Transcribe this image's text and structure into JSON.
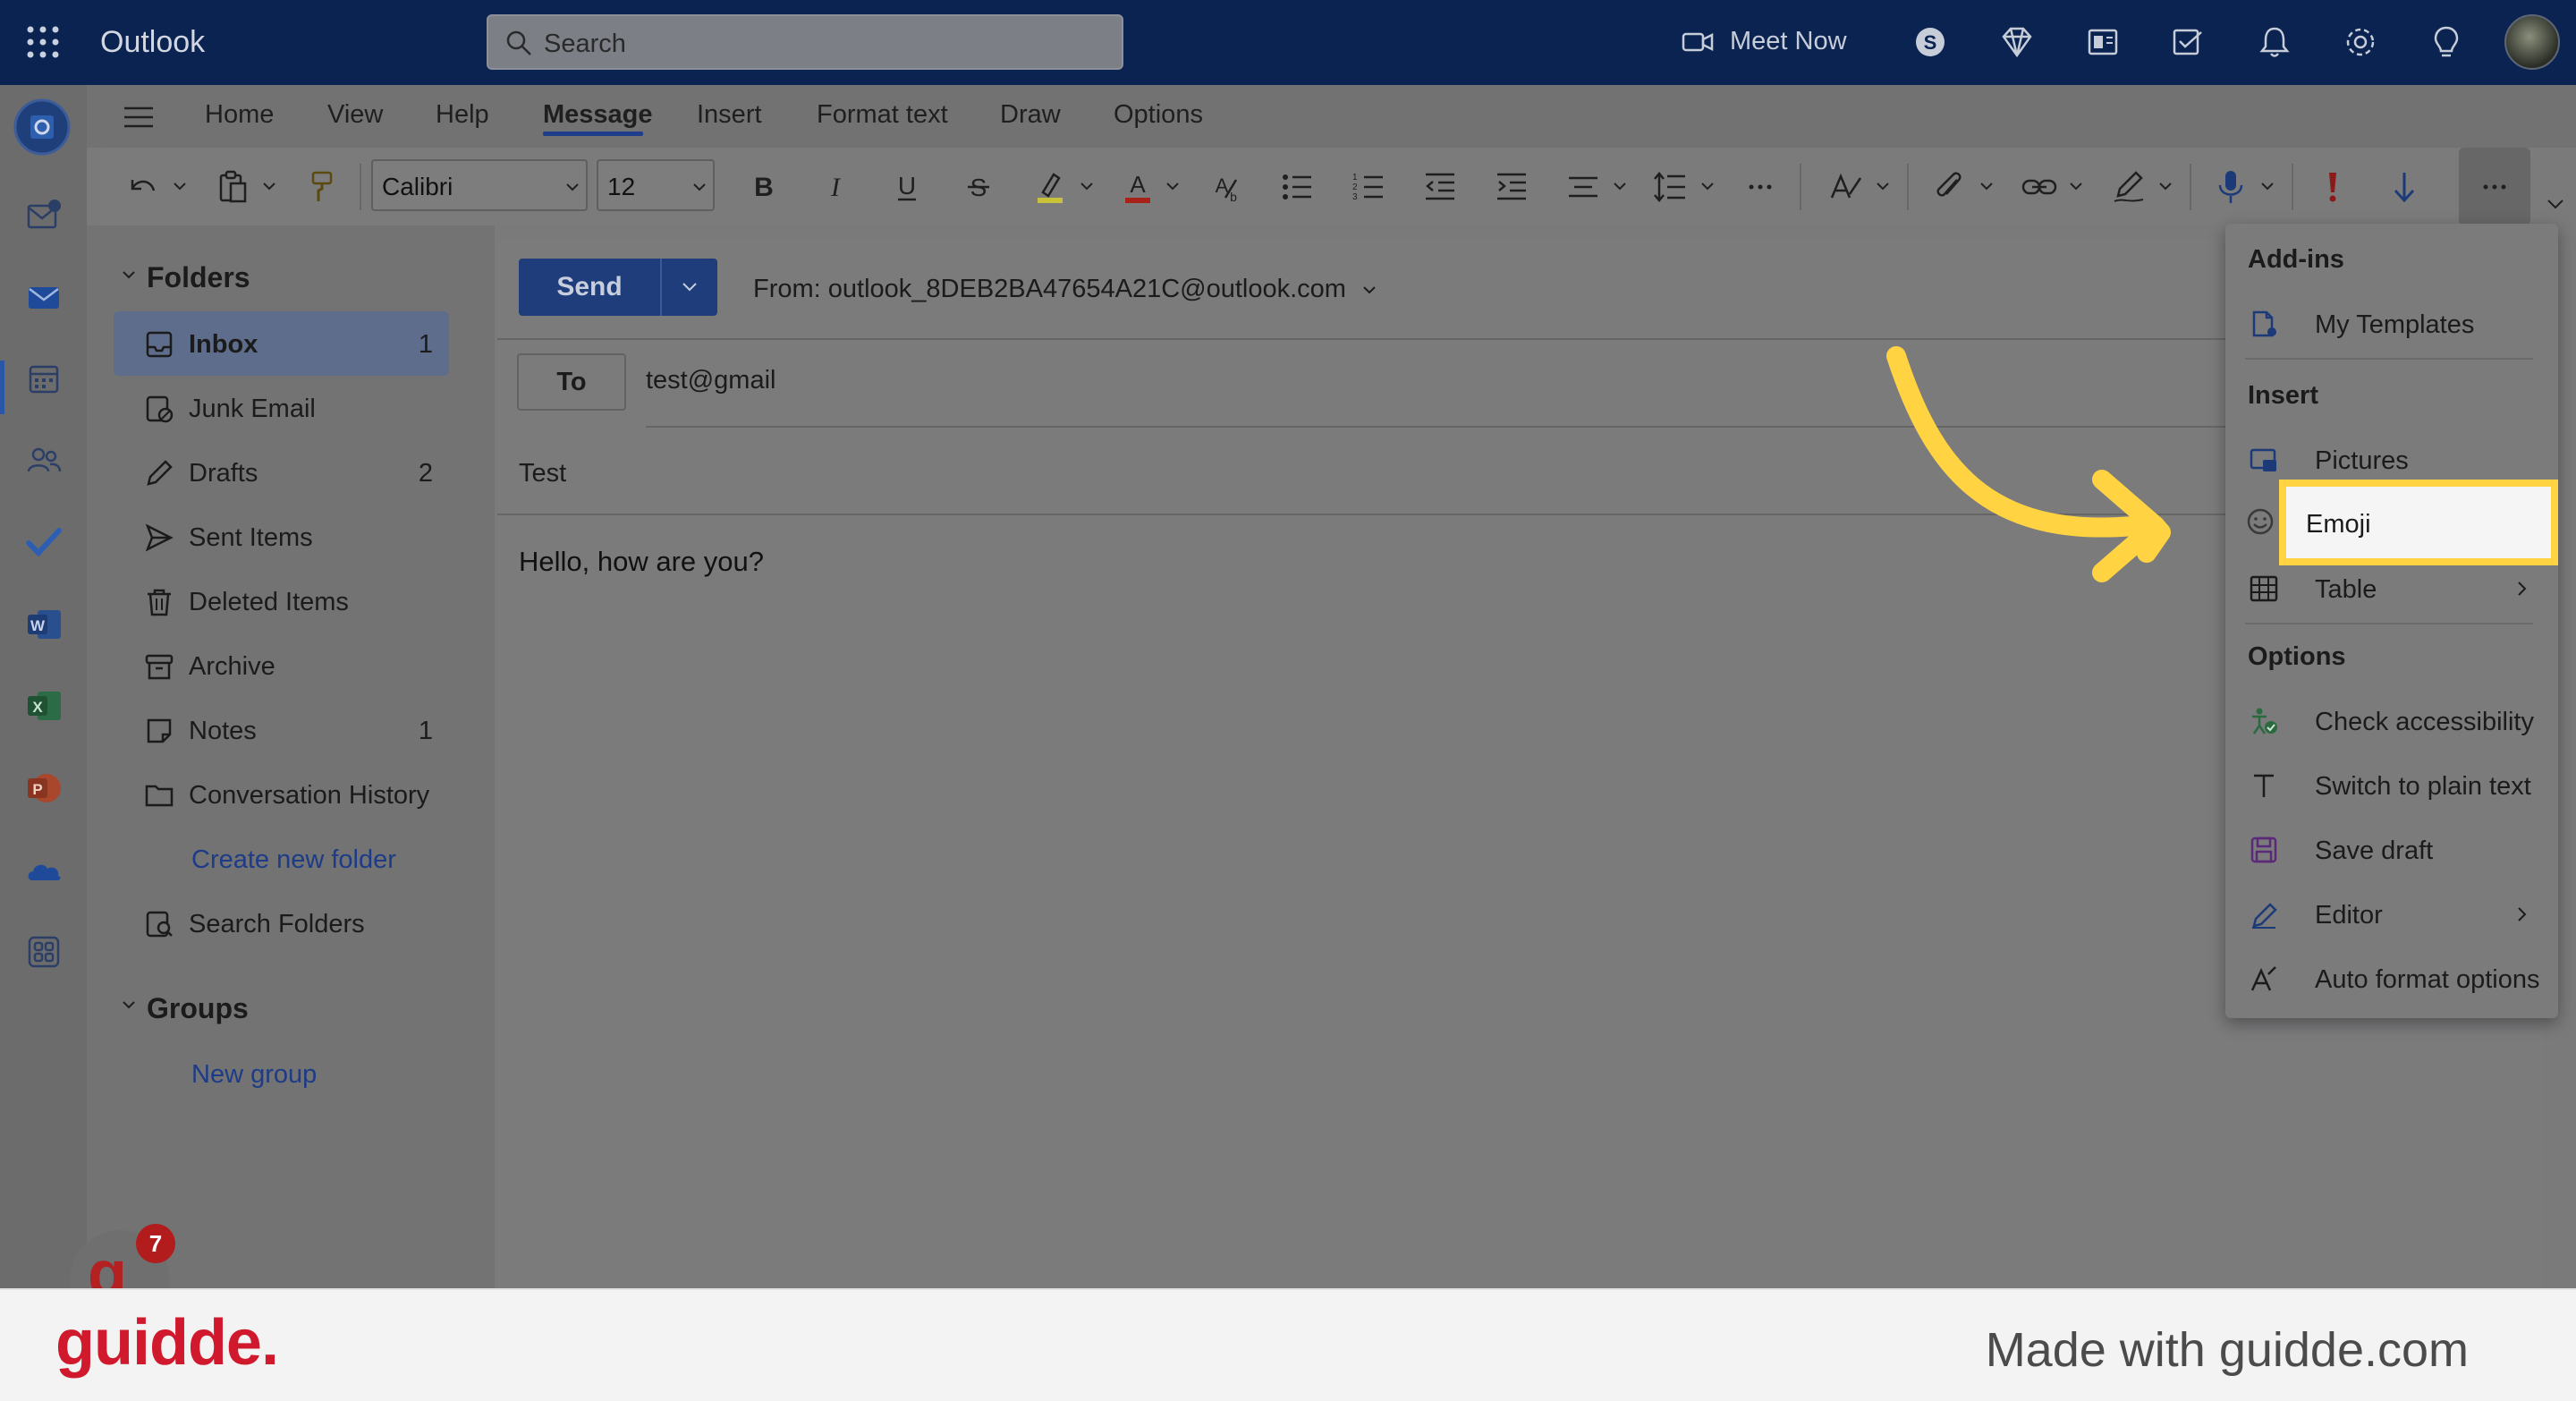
{
  "app": {
    "name": "Outlook"
  },
  "search": {
    "placeholder": "Search"
  },
  "topbar": {
    "meet_now": "Meet Now"
  },
  "ribbon": {
    "tabs": [
      "Home",
      "View",
      "Help",
      "Message",
      "Insert",
      "Format text",
      "Draw",
      "Options"
    ],
    "active_tab": "Message",
    "font_name": "Calibri",
    "font_size": "12"
  },
  "folders": {
    "header": "Folders",
    "items": [
      {
        "label": "Inbox",
        "count": "1"
      },
      {
        "label": "Junk Email",
        "count": ""
      },
      {
        "label": "Drafts",
        "count": "2"
      },
      {
        "label": "Sent Items",
        "count": ""
      },
      {
        "label": "Deleted Items",
        "count": ""
      },
      {
        "label": "Archive",
        "count": ""
      },
      {
        "label": "Notes",
        "count": "1"
      },
      {
        "label": "Conversation History",
        "count": ""
      }
    ],
    "create_new_folder": "Create new folder",
    "search_folders": "Search Folders",
    "groups_header": "Groups",
    "new_group": "New group"
  },
  "compose": {
    "send_label": "Send",
    "from": "From: outlook_8DEB2BA47654A21C@outlook.com",
    "to_label": "To",
    "to_value": "test@gmail",
    "subject": "Test",
    "body": "Hello, how are you?"
  },
  "menu": {
    "addins_header": "Add-ins",
    "my_templates": "My Templates",
    "insert_header": "Insert",
    "pictures": "Pictures",
    "emoji": "Emoji",
    "table": "Table",
    "options_header": "Options",
    "check_accessibility": "Check accessibility",
    "switch_plain_text": "Switch to plain text",
    "save_draft": "Save draft",
    "editor": "Editor",
    "auto_format": "Auto format options"
  },
  "notification": {
    "badge_count": "7"
  },
  "footer": {
    "logo": "guidde.",
    "made_with": "Made with guidde.com"
  },
  "colors": {
    "topbar": "#0b2350",
    "accent_yellow": "#ffd342",
    "brand_red": "#d0192c",
    "send_blue": "#1e3d7a"
  }
}
